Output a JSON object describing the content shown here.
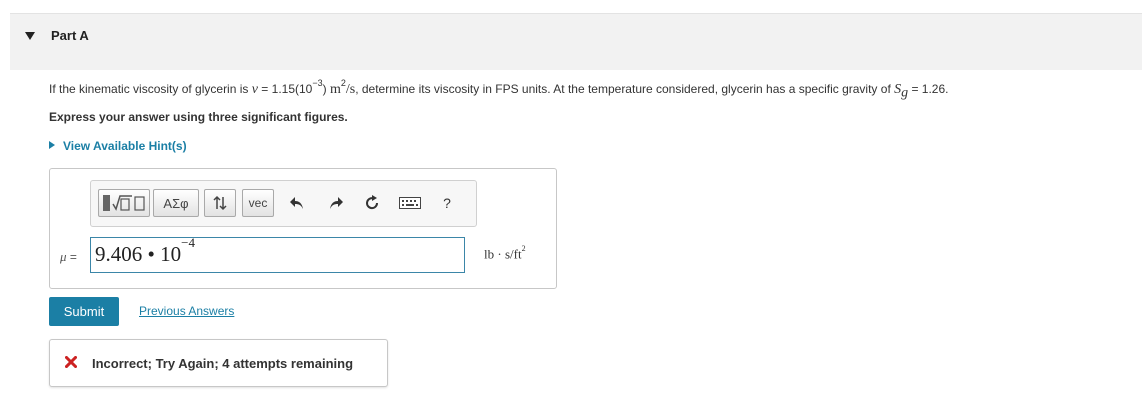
{
  "part": {
    "title": "Part A"
  },
  "question": {
    "lead": "If the kinematic viscosity of glycerin is",
    "nu_symbol": "ν",
    "nu_eq": " = 1.15(10",
    "nu_exp": "−3",
    "nu_close": ")",
    "nu_unit_m": "m",
    "nu_unit_m_exp": "2",
    "nu_unit_rest": "/s",
    "middle": ", determine its viscosity in FPS units. At the temperature considered, glycerin has a specific gravity of",
    "sg_symbol": "S",
    "sg_sub": "g",
    "sg_value": " = 1.26."
  },
  "instruction": "Express your answer using three significant figures.",
  "hint_link": "View Available Hint(s)",
  "toolbar": {
    "greek_label": "ΑΣφ",
    "vec_label": "vec",
    "help_label": "?"
  },
  "answer": {
    "variable_label": "μ =",
    "mantissa": "9.406 • 10",
    "exponent": "−4",
    "unit_main": "lb · s/ft",
    "unit_exp": "2"
  },
  "buttons": {
    "submit_label": "Submit",
    "previous_answers_label": "Previous Answers"
  },
  "feedback": {
    "message": "Incorrect; Try Again; 4 attempts remaining",
    "icon": "x-mark-icon",
    "color": "#cc2222"
  },
  "colors": {
    "accent": "#1b7fa5"
  }
}
